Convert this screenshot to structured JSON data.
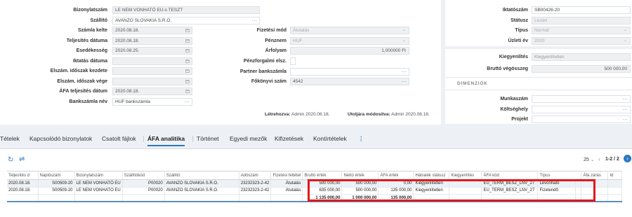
{
  "form_left": {
    "fields": [
      {
        "label": "Bizonylatszám",
        "value": "LE NEM VONHATÓ EU-s TESZT"
      },
      {
        "label": "Szállító",
        "value": "AVANZO SLOVAKIA S.R.O."
      },
      {
        "label": "Számla kelte",
        "value": "2020.08.18."
      },
      {
        "label": "Teljesítés dátuma",
        "value": "2020.08.18."
      },
      {
        "label": "Esedékesség",
        "value": "2020.08.25."
      },
      {
        "label": "Iktatás dátuma",
        "value": ""
      },
      {
        "label": "Elszám. időszak kezdete",
        "value": ""
      },
      {
        "label": "Elszám. időszak vége",
        "value": ""
      },
      {
        "label": "ÁFA teljesítés dátum",
        "value": "2020.08.18."
      },
      {
        "label": "Bankszámla név",
        "value": "HUF bankszámla"
      }
    ]
  },
  "form_mid": {
    "fields": [
      {
        "label": "Fizetési mód",
        "value": "Átutalás"
      },
      {
        "label": "Pénznem",
        "value": "HUF"
      },
      {
        "label": "Árfolyam",
        "value": "1,000000 Ft"
      },
      {
        "label": "Pénzforgalmi elsz.",
        "value": ""
      },
      {
        "label": "Partner bankszámla",
        "value": ""
      },
      {
        "label": "Főkönyvi szám",
        "value": "4542"
      }
    ],
    "created_label": "Létrehozva:",
    "created_value": "Admin 2020.08.18.",
    "modified_label": "Utoljára módosítva:",
    "modified_value": "Admin 2020.08.18."
  },
  "form_right": {
    "fields": [
      {
        "label": "Iktatószám",
        "value": "SB00426-20"
      },
      {
        "label": "Státusz",
        "value": "Lezárt"
      },
      {
        "label": "Típus",
        "value": "Normál"
      },
      {
        "label": "Üzleti év",
        "value": "2020"
      }
    ],
    "settle_label": "Kiegyenlítés",
    "settle_value": "Kiegyenlítetlen",
    "gross_balance_label": "Bruttó végösszeg",
    "gross_balance_value": "500 000,00",
    "dimensions_title": "DIMENZIÓK",
    "dimensions": [
      {
        "label": "Munkaszám",
        "value": ""
      },
      {
        "label": "Költséghely",
        "value": ""
      },
      {
        "label": "Projekt",
        "value": ""
      }
    ]
  },
  "tabs": [
    "Tételek",
    "Kapcsolódó bizonylatok",
    "Csatolt fájlok",
    "ÁFA analitika",
    "Történet",
    "Egyedi mezők",
    "Kifizetések",
    "Kontírtételek"
  ],
  "tabs_more": "⋮",
  "pagination": {
    "page_size": "25",
    "range": "1-2 / 2"
  },
  "table": {
    "columns": [
      "Teljesítés d",
      "Naplószám",
      "Bizonylatszám",
      "Szállítókód",
      "Szállító",
      "Adószám",
      "Fizetési feltétel",
      "Bruttó érték",
      "Nettó érték",
      "ÁFA érték",
      "Hátralék státusz",
      "Kiegyenlítés",
      "ÁFA kód",
      "Típus",
      "",
      "Áfa zárás",
      "Id"
    ],
    "rows": [
      [
        "2020.08.18.",
        "S00509-20",
        "LE NEM VONHATÓ EU",
        "P00020",
        "AVANZO SLOVAKIA S.R.O.",
        "23232323-2-42",
        "Átutalás",
        "500 000,00",
        "500 000,00",
        "0,00",
        "Kiegyenlítetlen",
        "",
        "EU_TERM_BESZ_LNV_27",
        "Levonható",
        "",
        "",
        ""
      ],
      [
        "2020.08.18.",
        "S00509-20",
        "LE NEM VONHATÓ EU",
        "P00020",
        "AVANZO SLOVAKIA S.R.O.",
        "23232323-2-42",
        "Átutalás",
        "635 000,00",
        "500 000,00",
        "135 000,00",
        "Kiegyenlítetlen",
        "",
        "EU_TERM_BESZ_LNV_27",
        "Fizetendő",
        "",
        "",
        ""
      ]
    ],
    "totals": [
      "",
      "",
      "",
      "",
      "",
      "",
      "",
      "1 135 000,00",
      "1 000 000,00",
      "135 000,00",
      "",
      "",
      "",
      "",
      "",
      "",
      ""
    ]
  },
  "colors": {
    "accent": "#2b78c2",
    "highlight": "#e0191b"
  }
}
